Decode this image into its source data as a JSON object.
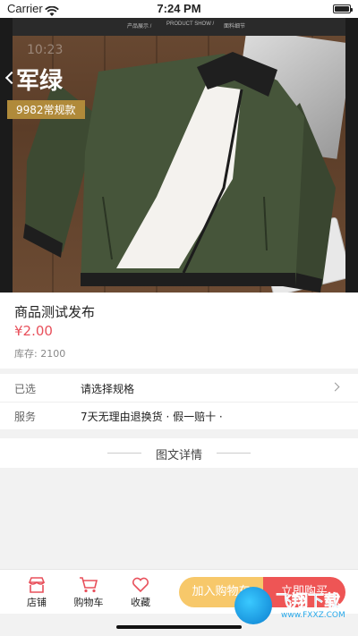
{
  "status_bar": {
    "carrier": "Carrier",
    "time": "7:24 PM"
  },
  "hero": {
    "overlay_time": "10:23",
    "color_label": "军绿",
    "tag_label": "9982常规款",
    "top_strip_items": [
      "产品展示 /",
      "PRODUCT SHOW /",
      "面料细节"
    ]
  },
  "product": {
    "title": "商品测试发布",
    "price": "¥2.00",
    "stock_label": "库存:",
    "stock_value": "2100"
  },
  "specs": {
    "selected_label": "已选",
    "selected_value": "请选择规格",
    "service_label": "服务",
    "service_value": "7天无理由退换货 ·   假一赔十 ·"
  },
  "detail": {
    "title": "图文详情"
  },
  "bottom_bar": {
    "shop_label": "店铺",
    "cart_label": "购物车",
    "favorite_label": "收藏",
    "add_to_cart_label": "加入购物车",
    "buy_now_label": "立即购买"
  },
  "watermark": {
    "text": "飞翔下载",
    "url": "www.FXXZ.COM"
  },
  "colors": {
    "price": "#e8505b",
    "add_to_cart": "#f7c86a",
    "buy_now": "#ee5555",
    "icon_accent": "#e8505b"
  }
}
